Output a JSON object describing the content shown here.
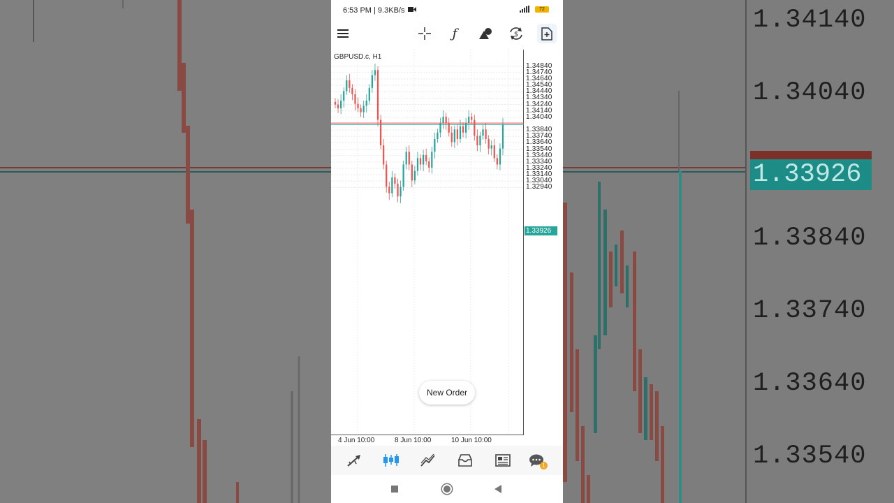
{
  "status": {
    "time_speed": "6:53 PM | 9.3KB/s",
    "battery": "72"
  },
  "chart": {
    "symbol": "GBPUSD.c, H1",
    "current_price": "1.33926",
    "new_order_label": "New Order"
  },
  "background": {
    "prices": [
      "1.34140",
      "1.34040",
      "1.33840",
      "1.33740",
      "1.33640",
      "1.33540"
    ],
    "badge": "1.33926"
  },
  "bottom_nav": {
    "items": [
      "quotes-icon",
      "chart-icon",
      "trade-icon",
      "history-icon",
      "news-icon",
      "messages-icon"
    ],
    "messages_badge": "1"
  },
  "colors": {
    "bull": "#26a69a",
    "bear": "#ef5350",
    "accent": "#2196f3"
  },
  "chart_data": {
    "type": "candlestick",
    "y_ticks": [
      "1.34840",
      "1.34740",
      "1.34640",
      "1.34540",
      "1.34440",
      "1.34340",
      "1.34240",
      "1.34140",
      "1.34040",
      "1.33840",
      "1.33740",
      "1.33640",
      "1.33540",
      "1.33440",
      "1.33340",
      "1.33240",
      "1.33140",
      "1.33040",
      "1.32940"
    ],
    "x_ticks": [
      "4 Jun 10:00",
      "8 Jun 10:00",
      "10 Jun 10:00"
    ],
    "ylim": [
      1.2906,
      1.351
    ],
    "bid": 1.33926,
    "ask": 1.3395,
    "closes": [
      1.3424,
      1.3418,
      1.343,
      1.3445,
      1.3462,
      1.345,
      1.344,
      1.3425,
      1.3418,
      1.3412,
      1.3422,
      1.343,
      1.345,
      1.347,
      1.3478,
      1.34,
      1.336,
      1.333,
      1.3295,
      1.3285,
      1.331,
      1.33,
      1.328,
      1.3295,
      1.333,
      1.335,
      1.333,
      1.3305,
      1.332,
      1.334,
      1.333,
      1.3345,
      1.3335,
      1.3325,
      1.335,
      1.337,
      1.338,
      1.3395,
      1.3405,
      1.3395,
      1.338,
      1.3365,
      1.3385,
      1.337,
      1.339,
      1.338,
      1.3395,
      1.3405,
      1.34,
      1.3375,
      1.336,
      1.3375,
      1.3385,
      1.337,
      1.3355,
      1.336,
      1.334,
      1.333,
      1.3355,
      1.3393
    ]
  }
}
